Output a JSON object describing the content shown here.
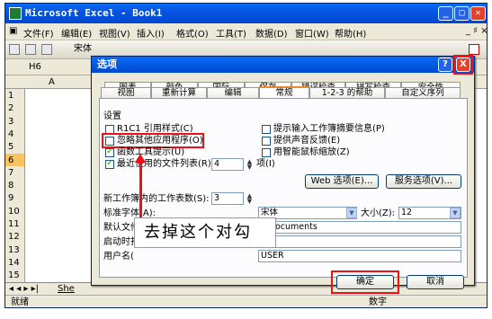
{
  "excel": {
    "title": "Microsoft Excel - Book1",
    "menu": [
      "文件(F)",
      "编辑(E)",
      "视图(V)",
      "插入(I)",
      "格式(O)",
      "工具(T)",
      "数据(D)",
      "窗口(W)",
      "帮助(H)"
    ],
    "font_box": "宋体",
    "name_box": "H6",
    "column_a": "A",
    "rows": [
      "1",
      "2",
      "3",
      "4",
      "5",
      "6",
      "7",
      "8",
      "9",
      "10",
      "11",
      "12",
      "13",
      "14",
      "15"
    ],
    "selected_row": "6",
    "sheet_tab": "She",
    "status": "就绪",
    "status_num": "数字"
  },
  "dialog": {
    "title": "选项",
    "help_glyph": "?",
    "close_glyph": "X",
    "tabs_row1": [
      "图表",
      "颜色",
      "国际",
      "保存",
      "错误检查",
      "拼写检查",
      "安全性"
    ],
    "tabs_row2": [
      "视图",
      "重新计算",
      "编辑",
      "常规",
      "1-2-3 的帮助",
      "自定义序列"
    ],
    "active_tab": "常规",
    "section_settings": "设置",
    "left_options": [
      {
        "label": "R1C1 引用样式(C)",
        "checked": false
      },
      {
        "label": "忽略其他应用程序(O)",
        "checked": false
      },
      {
        "label": "函数工具提示(U)",
        "checked": true
      },
      {
        "label": "最近使用的文件列表(R):",
        "checked": true
      }
    ],
    "recent_count": "4",
    "recent_unit": "项(I)",
    "right_options": [
      {
        "label": "提示输入工作簿摘要信息(P)",
        "checked": false
      },
      {
        "label": "提供声音反馈(E)",
        "checked": false
      },
      {
        "label": "用智能鼠标缩放(Z)",
        "checked": false
      }
    ],
    "web_button": "Web 选项(E)...",
    "service_button": "服务选项(V)...",
    "sheets_label": "新工作簿内的工作表数(S):",
    "sheets_value": "3",
    "std_font_label": "标准字体(A):",
    "std_font_value": "宋体",
    "size_label": "大小(Z):",
    "size_value": "12",
    "default_loc_label": "默认文件位",
    "default_loc_value": "y Documents",
    "startup_label": "启动时打",
    "username_label": "用户名(",
    "username_value": "USER",
    "ok_button": "确定",
    "cancel_button": "取消"
  },
  "annotation": {
    "text": "去掉这个对勾"
  },
  "colors": {
    "highlight": "#ee1111",
    "title_bar": "#0454e2"
  }
}
